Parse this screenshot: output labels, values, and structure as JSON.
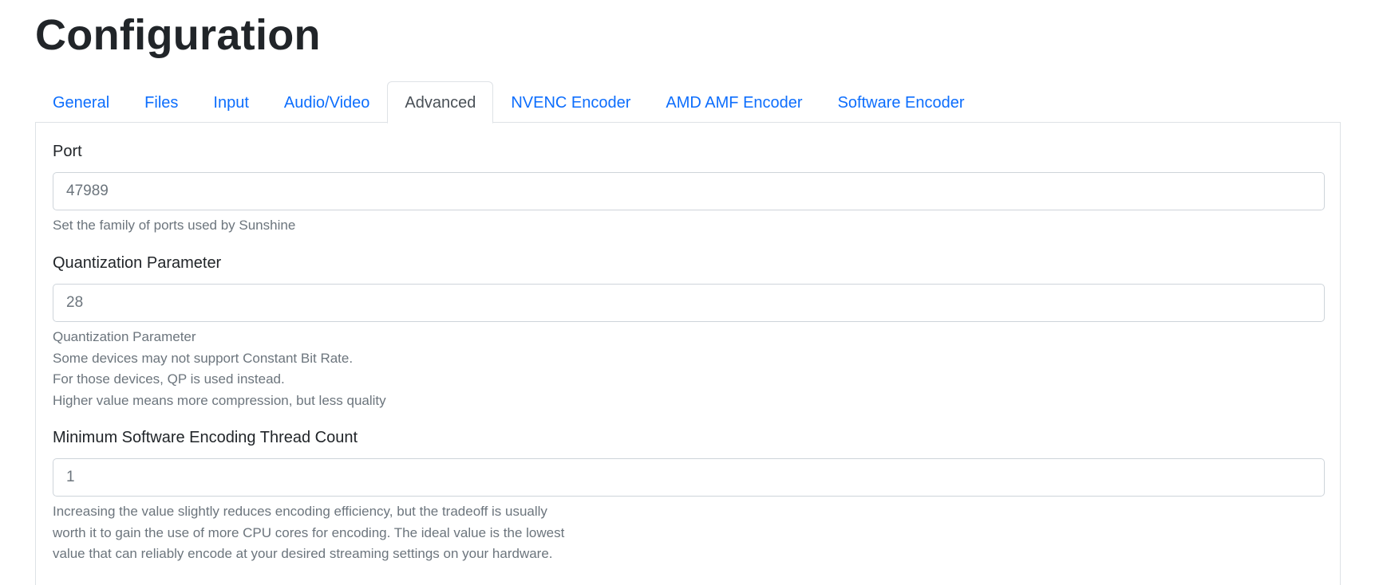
{
  "page": {
    "title": "Configuration"
  },
  "tabs": [
    {
      "label": "General"
    },
    {
      "label": "Files"
    },
    {
      "label": "Input"
    },
    {
      "label": "Audio/Video"
    },
    {
      "label": "Advanced",
      "active": true
    },
    {
      "label": "NVENC Encoder"
    },
    {
      "label": "AMD AMF Encoder"
    },
    {
      "label": "Software Encoder"
    }
  ],
  "fields": {
    "port": {
      "label": "Port",
      "value": "47989",
      "help": [
        "Set the family of ports used by Sunshine"
      ]
    },
    "qp": {
      "label": "Quantization Parameter",
      "value": "28",
      "help": [
        "Quantization Parameter",
        "Some devices may not support Constant Bit Rate.",
        "For those devices, QP is used instead.",
        "Higher value means more compression, but less quality"
      ]
    },
    "min_threads": {
      "label": "Minimum Software Encoding Thread Count",
      "value": "1",
      "help": [
        "Increasing the value slightly reduces encoding efficiency, but the tradeoff is usually",
        "worth it to gain the use of more CPU cores for encoding. The ideal value is the lowest",
        "value that can reliably encode at your desired streaming settings on your hardware."
      ]
    }
  },
  "colors": {
    "link": "#0d6efd",
    "active_tab_text": "#495057",
    "muted": "#6c757d",
    "border": "#dee2e6"
  }
}
